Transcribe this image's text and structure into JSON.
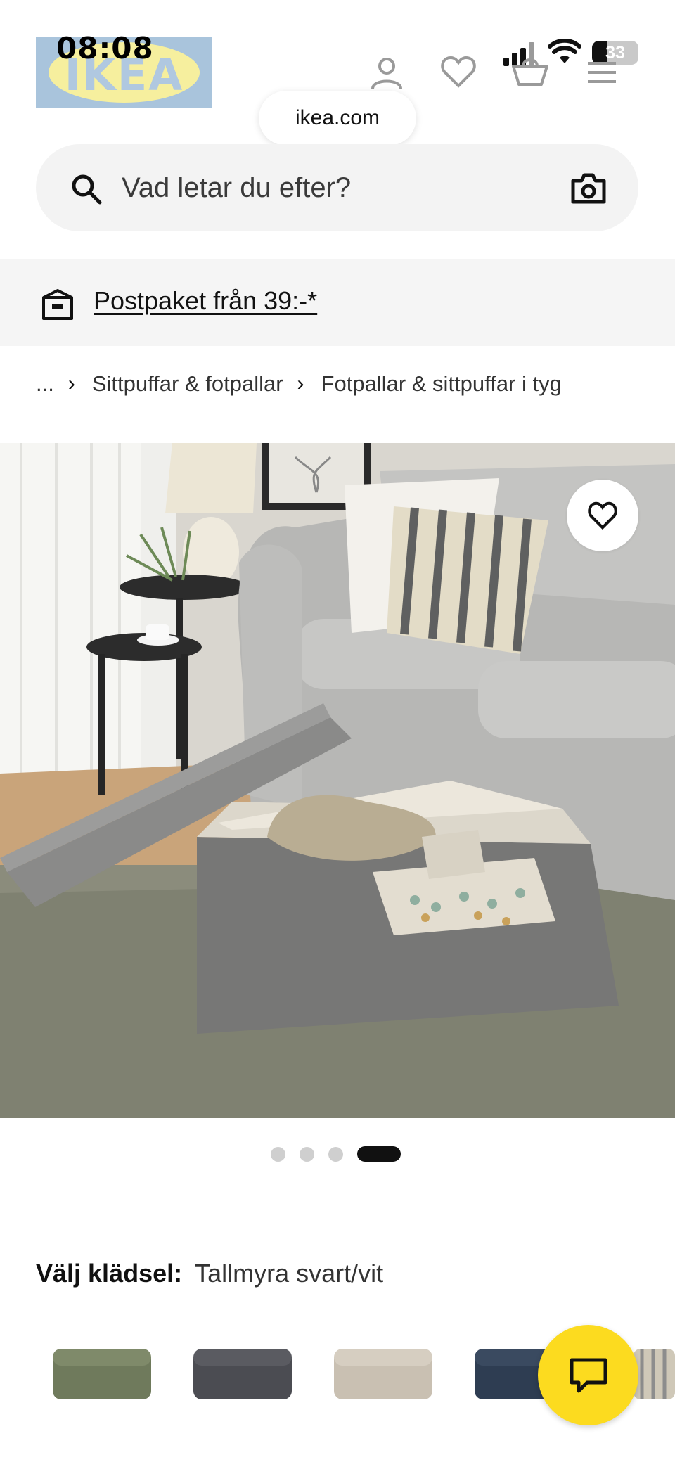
{
  "status_bar": {
    "time": "08:08",
    "battery": "33"
  },
  "header": {
    "logo_text": "IKEA",
    "icons": [
      "user-icon",
      "heart-icon",
      "cart-icon",
      "menu-icon"
    ]
  },
  "browser": {
    "url": "ikea.com"
  },
  "search": {
    "placeholder": "Vad letar du efter?"
  },
  "promo": {
    "text": "Postpaket från 39:-*"
  },
  "breadcrumb": {
    "ellipsis": "...",
    "items": [
      "Sittpuffar & fotpallar",
      "Fotpallar & sittpuffar i tyg"
    ]
  },
  "gallery": {
    "image_count": 4,
    "active_index": 3
  },
  "fabric": {
    "label": "Välj klädsel:",
    "value": "Tallmyra svart/vit"
  },
  "swatches": [
    {
      "color": "#6f7a5c"
    },
    {
      "color": "#4b4c52"
    },
    {
      "color": "#c9c0b2"
    },
    {
      "color": "#2e3d52"
    },
    {
      "color": "#cfc8b8"
    }
  ],
  "colors": {
    "brand_yellow": "#fcdb1f",
    "brand_blue": "#a9c4dc"
  }
}
